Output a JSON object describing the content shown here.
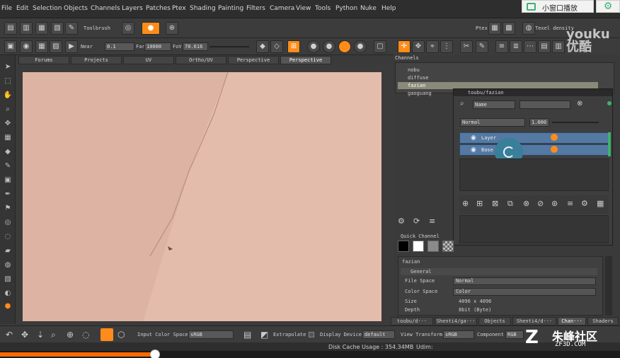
{
  "menu": [
    "File",
    "Edit",
    "Selection",
    "Objects",
    "Channels",
    "Layers",
    "Patches",
    "Ptex",
    "Shading",
    "Painting",
    "Filters",
    "Camera",
    "View",
    "Tools",
    "Python",
    "Nuke",
    "Help"
  ],
  "overlay": {
    "pip_label": "小窗口播放"
  },
  "toolbar1": {
    "toolbrush_label": "Toolbrush",
    "ptex_label": "Ptex",
    "texel_density_label": "Texel density"
  },
  "toolbar2": {
    "near_label": "Near",
    "near_value": "0.1",
    "far_label": "Far",
    "far_value": "10000",
    "fov_label": "FoV",
    "fov_value": "70.616"
  },
  "viewport_tabs": [
    "Forums",
    "Projects",
    "UV",
    "Ortho/UV",
    "Perspective",
    "Perspective"
  ],
  "channels": {
    "title": "Channels",
    "items": [
      "nobu",
      "diffuse",
      "fazian",
      "gaoguang"
    ]
  },
  "layers_window": {
    "title": "toubu/fazian",
    "filter_label": "Name",
    "blend_mode": "Normal",
    "opacity": "1.000",
    "layers": [
      "Layer",
      "Base"
    ]
  },
  "quick_channel": {
    "title": "Quick Channel"
  },
  "properties": {
    "title": "fazian",
    "group": "General",
    "rows": [
      {
        "label": "File Space",
        "value": "Normal"
      },
      {
        "label": "Color Space",
        "value": "Color"
      },
      {
        "label": "Size",
        "value": "4096 x 4096"
      },
      {
        "label": "Depth",
        "value": "8bit (Byte)"
      }
    ]
  },
  "bottom_tabs": [
    "toubu/d···",
    "Shenti4/ga···",
    "Objects",
    "Shenti4/d···",
    "Chan···",
    "Shaders"
  ],
  "bottombar": {
    "input_cs_label": "Input Color Space",
    "input_cs_value": "sRGB",
    "extrapolate_label": "Extrapolate",
    "display_device_label": "Display Device",
    "display_device_value": "default",
    "view_transform_label": "View Transform",
    "view_transform_value": "sRGB",
    "component_label": "Component",
    "component_value": "RGB"
  },
  "status": {
    "disk_cache": "Disk Cache Usage : 354.34MB",
    "udim": "Udim:"
  },
  "playback": {
    "progress": 0.25
  },
  "watermarks": {
    "youku_en": "youku",
    "youku_cn": "优酷",
    "zf3d_cn": "朱峰社区",
    "zf3d_en": "ZF3D.COM"
  },
  "colors": {
    "accent_orange": "#ff8c1a",
    "layer_selected": "#5479a3",
    "canvas_skin": "#ddb3a3",
    "green_badge": "#3cb371"
  }
}
